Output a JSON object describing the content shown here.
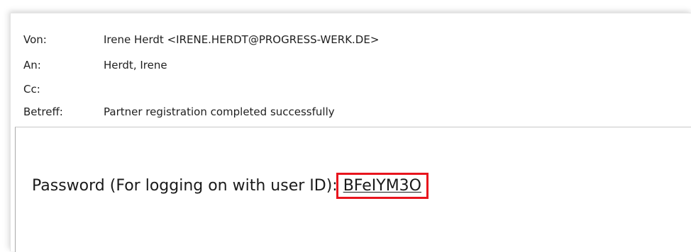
{
  "header": {
    "von_label": "Von:",
    "von_value": "Irene Herdt <IRENE.HERDT@PROGRESS-WERK.DE>",
    "an_label": "An:",
    "an_value": "Herdt, Irene",
    "cc_label": "Cc:",
    "cc_value": "",
    "betreff_label": "Betreff:",
    "betreff_value": "Partner registration completed successfully"
  },
  "body": {
    "password_label": "Password (For logging on with user ID):",
    "password_value": "BFeIYM3O"
  },
  "colors": {
    "highlight_box": "#e8141d",
    "text": "#1f1f1f"
  }
}
